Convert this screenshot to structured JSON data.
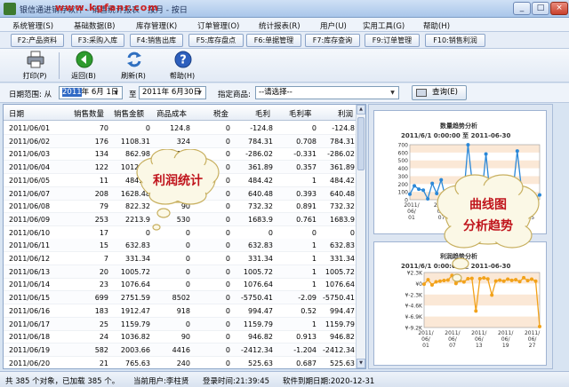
{
  "window": {
    "title": "银信通进销存软件 - 销售统计报表 - 按月 - 按日",
    "watermark": "www.kgfanr.com",
    "controls": [
      "_",
      "□",
      "×"
    ]
  },
  "menu": [
    "系统管理(S)",
    "基础数据(B)",
    "库存管理(K)",
    "订单管理(O)",
    "统计报表(R)",
    "用户(U)",
    "实用工具(G)",
    "帮助(H)"
  ],
  "fkeys": [
    "F2:产品资料",
    "F3:采购入库",
    "F4:销售出库",
    "F5:库存盘点",
    "F6:单据管理",
    "F7:库存查询",
    "F9:订单管理",
    "F10:销售利润"
  ],
  "toolbar": {
    "print": "打印(P)",
    "back": "返回(B)",
    "refresh": "刷新(R)",
    "help": "帮助(H)"
  },
  "filter": {
    "range_label": "日期范围: 从",
    "from_year": "2011",
    "from_rest": "年 6月 1日",
    "to_label": "至",
    "to_value": "2011年 6月30日",
    "product_label": "指定商品:",
    "product_value": "--请选择--",
    "query": "查询(E)"
  },
  "table": {
    "columns": [
      "日期",
      "销售数量",
      "销售金额",
      "商品成本",
      "税金",
      "毛利",
      "毛利率",
      "利润"
    ],
    "rows": [
      [
        "2011/06/01",
        "70",
        "0",
        "124.8",
        "0",
        "-124.8",
        "0",
        "-124.8"
      ],
      [
        "2011/06/02",
        "176",
        "1108.31",
        "324",
        "0",
        "784.31",
        "0.708",
        "784.31"
      ],
      [
        "2011/06/03",
        "134",
        "862.98",
        "1149",
        "0",
        "-286.02",
        "-0.331",
        "-286.02"
      ],
      [
        "2011/06/04",
        "122",
        "1012.89",
        "651",
        "0",
        "361.89",
        "0.357",
        "361.89"
      ],
      [
        "2011/06/05",
        "11",
        "484.42",
        "0",
        "0",
        "484.42",
        "1",
        "484.42"
      ],
      [
        "2011/06/07",
        "208",
        "1628.48",
        "988",
        "0",
        "640.48",
        "0.393",
        "640.48"
      ],
      [
        "2011/06/08",
        "79",
        "822.32",
        "90",
        "0",
        "732.32",
        "0.891",
        "732.32"
      ],
      [
        "2011/06/09",
        "253",
        "2213.9",
        "530",
        "0",
        "1683.9",
        "0.761",
        "1683.9"
      ],
      [
        "2011/06/10",
        "17",
        "0",
        "0",
        "0",
        "0",
        "0",
        "0"
      ],
      [
        "2011/06/11",
        "15",
        "632.83",
        "0",
        "0",
        "632.83",
        "1",
        "632.83"
      ],
      [
        "2011/06/12",
        "7",
        "331.34",
        "0",
        "0",
        "331.34",
        "1",
        "331.34"
      ],
      [
        "2011/06/13",
        "20",
        "1005.72",
        "0",
        "0",
        "1005.72",
        "1",
        "1005.72"
      ],
      [
        "2011/06/14",
        "23",
        "1076.64",
        "0",
        "0",
        "1076.64",
        "1",
        "1076.64"
      ],
      [
        "2011/06/15",
        "699",
        "2751.59",
        "8502",
        "0",
        "-5750.41",
        "-2.09",
        "-5750.41"
      ],
      [
        "2011/06/16",
        "183",
        "1912.47",
        "918",
        "0",
        "994.47",
        "0.52",
        "994.47"
      ],
      [
        "2011/06/17",
        "25",
        "1159.79",
        "0",
        "0",
        "1159.79",
        "1",
        "1159.79"
      ],
      [
        "2011/06/18",
        "24",
        "1036.82",
        "90",
        "0",
        "946.82",
        "0.913",
        "946.82"
      ],
      [
        "2011/06/19",
        "582",
        "2003.66",
        "4416",
        "0",
        "-2412.34",
        "-1.204",
        "-2412.34"
      ],
      [
        "2011/06/20",
        "21",
        "765.63",
        "240",
        "0",
        "525.63",
        "0.687",
        "525.63"
      ]
    ]
  },
  "status": {
    "count": "共 385 个对象，已加载 385 个。",
    "user": "当前用户:李柱贤",
    "login": "登录时间:21:39:45",
    "expiry": "软件到期日期:2020-12-31"
  },
  "callouts": {
    "profit": "利润统计",
    "curve1": "曲线图",
    "curve2": "分析趋势"
  },
  "chart_data": [
    {
      "type": "line",
      "title": "数量趋势分析",
      "subtitle": "2011/6/1 0:00:00 至 2011-06-30",
      "ylim": [
        0,
        700
      ],
      "yticks": [
        "0",
        "100",
        "200",
        "300",
        "400",
        "500",
        "600",
        "700"
      ],
      "x_ticks": [
        "2011/06/01",
        "2011/06/07",
        "2011/06/13",
        "2011/06/19",
        "2011/06/25"
      ],
      "series": [
        {
          "name": "",
          "values": [
            70,
            176,
            134,
            122,
            11,
            208,
            79,
            253,
            17,
            15,
            7,
            20,
            23,
            699,
            183,
            25,
            24,
            582,
            21,
            110,
            60,
            200,
            40,
            90,
            620,
            100,
            30,
            70,
            25,
            60
          ]
        }
      ]
    },
    {
      "type": "line",
      "title": "利润趋势分析",
      "subtitle": "2011/6/1 0:00:00 至 2011-06-30",
      "ylim": [
        -9200,
        2300
      ],
      "yticks": [
        "¥2.3K",
        "¥0",
        "¥-2.3K",
        "¥-4.6K",
        "¥-6.9K",
        "¥-9.2K"
      ],
      "x_ticks": [
        "2011/06/01",
        "2011/06/07",
        "2011/06/13",
        "2011/06/19",
        "2011/06/27"
      ],
      "series": [
        {
          "name": "",
          "values": [
            -124.8,
            784.31,
            -286.02,
            361.89,
            484.42,
            640.48,
            732.32,
            1683.9,
            0,
            632.83,
            331.34,
            1005.72,
            1076.64,
            -5750.41,
            994.47,
            1159.79,
            946.82,
            -2412.34,
            525.63,
            700,
            500,
            900,
            650,
            800,
            400,
            1200,
            600,
            900,
            500,
            -9000
          ]
        }
      ]
    }
  ]
}
